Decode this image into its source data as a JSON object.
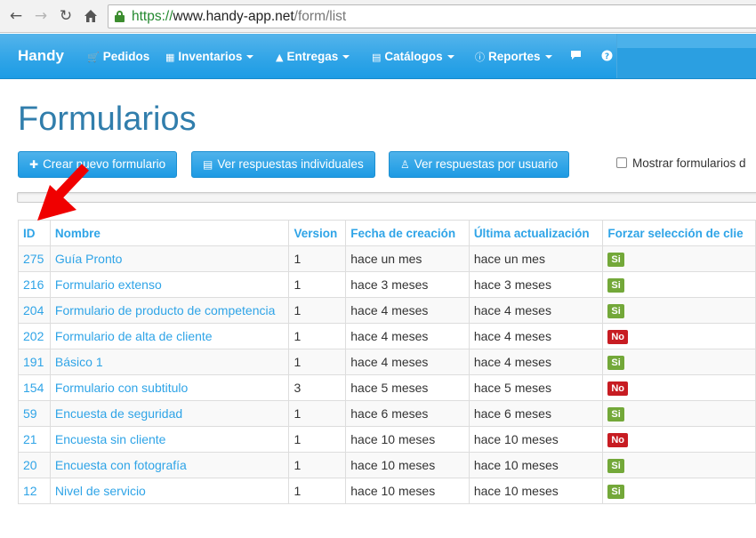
{
  "browser": {
    "url_scheme": "https://",
    "url_host": "www.handy-app.net",
    "url_path": "/form/list",
    "back_icon": "arrow-left",
    "forward_icon": "arrow-right",
    "reload_icon": "reload",
    "home_icon": "home"
  },
  "navbar": {
    "brand": "Handy",
    "items": [
      {
        "label": "Pedidos",
        "icon": "cart"
      },
      {
        "label": "Inventarios",
        "icon": "grid"
      },
      {
        "label": "Entregas",
        "icon": "road"
      },
      {
        "label": "Catálogos",
        "icon": "list"
      },
      {
        "label": "Reportes",
        "icon": "info"
      }
    ],
    "chat_icon": "comment",
    "help_icon": "question"
  },
  "page": {
    "title": "Formularios"
  },
  "actions": {
    "create": "Crear nuevo formulario",
    "individual": "Ver respuestas individuales",
    "by_user": "Ver respuestas por usuario",
    "show_toggle": "Mostrar formularios d"
  },
  "table": {
    "headers": [
      "ID",
      "Nombre",
      "Version",
      "Fecha de creación",
      "Última actualización",
      "Forzar selección de clie"
    ],
    "rows": [
      {
        "id": "275",
        "name": "Guía Pronto",
        "version": "1",
        "created": "hace un mes",
        "updated": "hace un mes",
        "force": "Si"
      },
      {
        "id": "216",
        "name": "Formulario extenso",
        "version": "1",
        "created": "hace 3 meses",
        "updated": "hace 3 meses",
        "force": "Si"
      },
      {
        "id": "204",
        "name": "Formulario de producto de competencia",
        "version": "1",
        "created": "hace 4 meses",
        "updated": "hace 4 meses",
        "force": "Si"
      },
      {
        "id": "202",
        "name": "Formulario de alta de cliente",
        "version": "1",
        "created": "hace 4 meses",
        "updated": "hace 4 meses",
        "force": "No"
      },
      {
        "id": "191",
        "name": "Básico 1",
        "version": "1",
        "created": "hace 4 meses",
        "updated": "hace 4 meses",
        "force": "Si"
      },
      {
        "id": "154",
        "name": "Formulario con subtitulo",
        "version": "3",
        "created": "hace 5 meses",
        "updated": "hace 5 meses",
        "force": "No"
      },
      {
        "id": "59",
        "name": "Encuesta de seguridad",
        "version": "1",
        "created": "hace 6 meses",
        "updated": "hace 6 meses",
        "force": "Si"
      },
      {
        "id": "21",
        "name": "Encuesta sin cliente",
        "version": "1",
        "created": "hace 10 meses",
        "updated": "hace 10 meses",
        "force": "No"
      },
      {
        "id": "20",
        "name": "Encuesta con fotografía",
        "version": "1",
        "created": "hace 10 meses",
        "updated": "hace 10 meses",
        "force": "Si"
      },
      {
        "id": "12",
        "name": "Nivel de servicio",
        "version": "1",
        "created": "hace 10 meses",
        "updated": "hace 10 meses",
        "force": "Si"
      }
    ]
  },
  "colors": {
    "navbar": "#2fa4e7",
    "title": "#317eac",
    "badge_yes": "#73a839",
    "badge_no": "#c71c22",
    "annotation_arrow": "#ff0000"
  },
  "annotation": {
    "icon": "red-arrow",
    "points_to": "ID"
  }
}
